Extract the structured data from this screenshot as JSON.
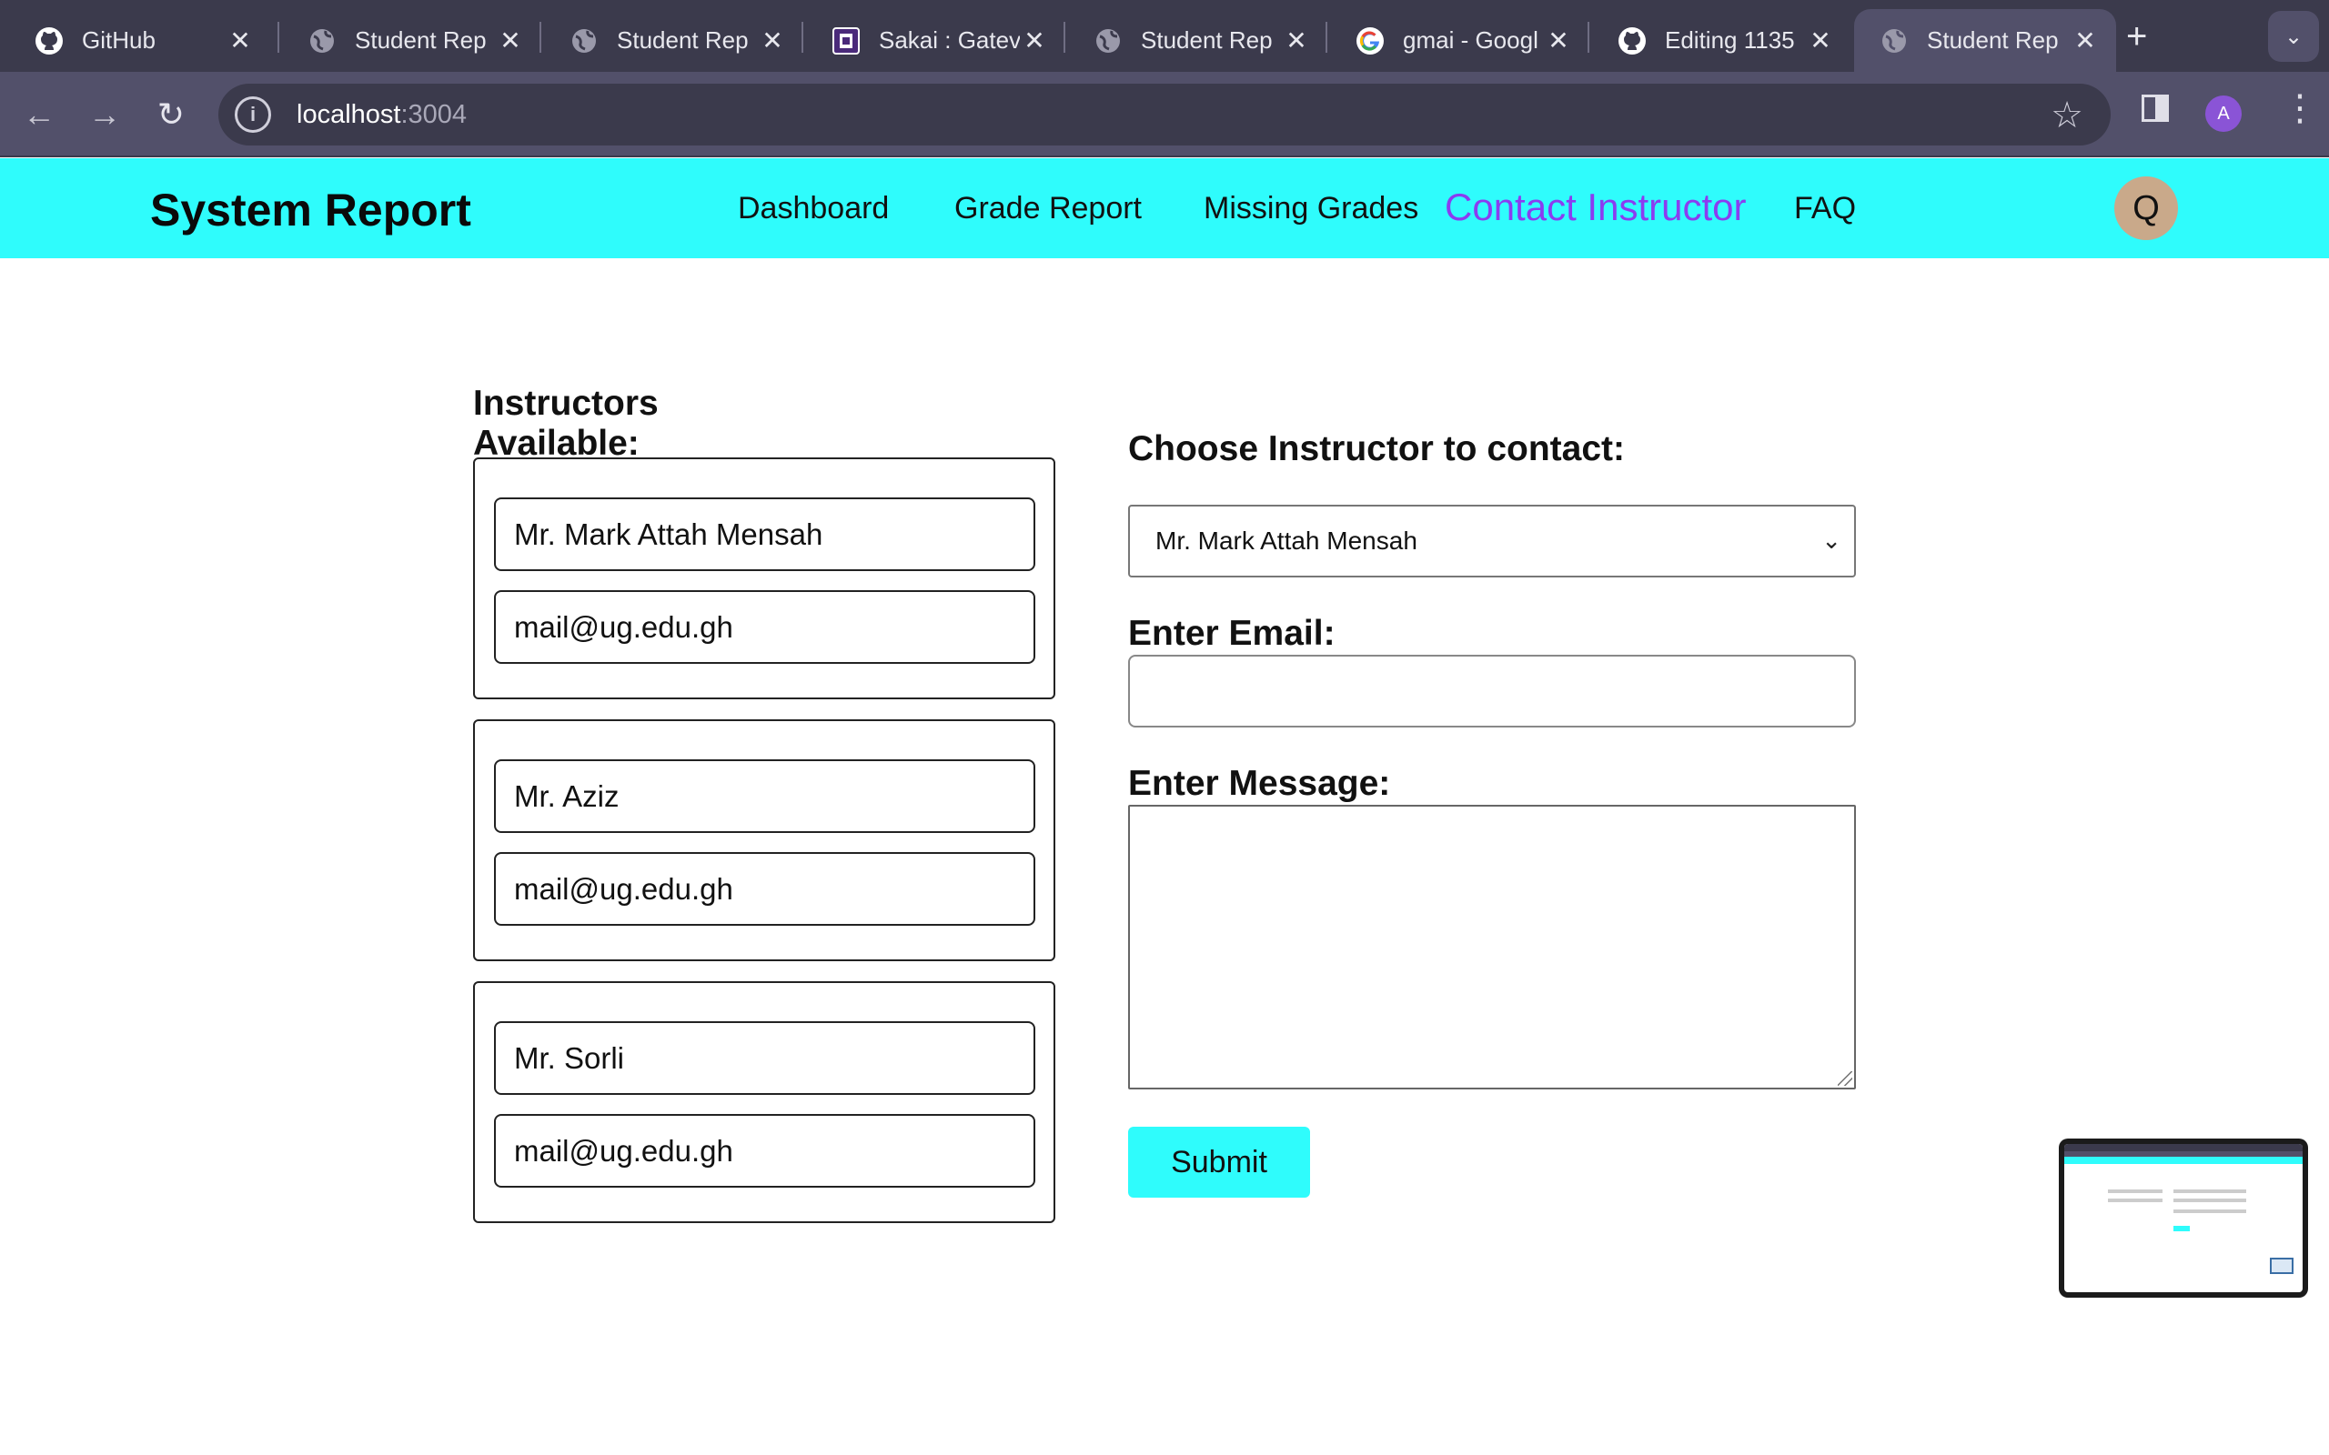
{
  "browser": {
    "tabs": [
      {
        "title": "GitHub",
        "icon": "github-icon"
      },
      {
        "title": "Student Rep",
        "icon": "globe-icon"
      },
      {
        "title": "Student Rep",
        "icon": "globe-icon"
      },
      {
        "title": "Sakai : Gatev",
        "icon": "sakai-icon"
      },
      {
        "title": "Student Rep",
        "icon": "globe-icon"
      },
      {
        "title": "gmai - Googl",
        "icon": "google-icon"
      },
      {
        "title": "Editing 1135",
        "icon": "github-icon"
      },
      {
        "title": "Student Rep",
        "icon": "globe-icon",
        "active": true
      }
    ],
    "close_glyph": "✕",
    "new_tab_glyph": "+",
    "url_host": "localhost",
    "url_port": ":3004",
    "profile_initial": "A"
  },
  "app": {
    "brand": "System Report",
    "nav": [
      {
        "label": "Dashboard"
      },
      {
        "label": "Grade Report"
      },
      {
        "label": "Missing Grades"
      },
      {
        "label": "Contact Instructor",
        "active": true
      },
      {
        "label": "FAQ"
      }
    ],
    "user_initial": "Q",
    "accent_color": "#2ffcfc",
    "active_nav_color": "#8b3cf0"
  },
  "instructors": {
    "heading": "Instructors Available:",
    "list": [
      {
        "name": "Mr. Mark Attah Mensah",
        "email": "mail@ug.edu.gh"
      },
      {
        "name": "Mr. Aziz",
        "email": "mail@ug.edu.gh"
      },
      {
        "name": "Mr. Sorli",
        "email": "mail@ug.edu.gh"
      }
    ]
  },
  "contact_form": {
    "choose_label": "Choose Instructor to contact:",
    "selected_instructor": "Mr. Mark Attah Mensah",
    "email_label": "Enter Email:",
    "email_value": "",
    "message_label": "Enter Message:",
    "message_value": "",
    "submit_label": "Submit"
  }
}
